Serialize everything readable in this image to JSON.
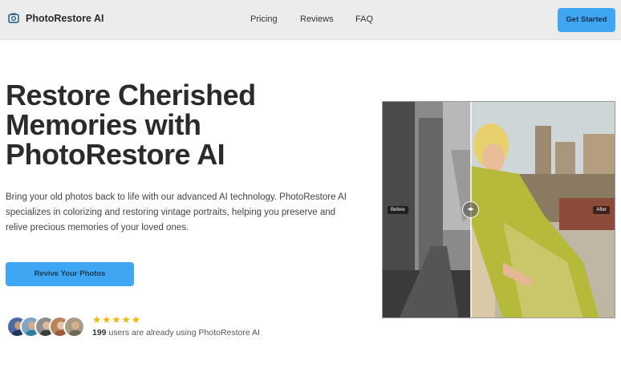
{
  "nav": {
    "brand": "PhotoRestore AI",
    "links": [
      "Pricing",
      "Reviews",
      "FAQ"
    ],
    "cta": "Get Started",
    "brand_icon": "camera-frame-icon"
  },
  "hero": {
    "title": "Restore Cherished Memories with PhotoRestore AI",
    "description": "Bring your old photos back to life with our advanced AI technology. PhotoRestore AI specializes in colorizing and restoring vintage portraits, helping you preserve and relive precious memories of your loved ones.",
    "cta": "Revive Your Photos"
  },
  "social_proof": {
    "stars": "★★★★★",
    "rating": 5,
    "user_count": "199",
    "user_text": " users are already using PhotoRestore AI"
  },
  "comparison": {
    "before_label": "Before",
    "after_label": "After",
    "slider_position": 0.38,
    "handle_icon": "left-right-arrows-icon"
  },
  "colors": {
    "accent": "#3ea6f2",
    "nav_bg": "#ececec",
    "star": "#f4b400"
  }
}
